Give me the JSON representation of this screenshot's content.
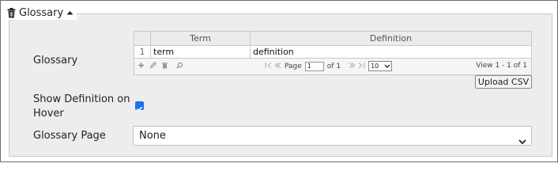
{
  "section": {
    "title": "Glossary"
  },
  "fields": {
    "glossary_label": "Glossary",
    "show_definition_label": "Show Definition on Hover",
    "show_definition_checked": true,
    "glossary_page_label": "Glossary Page",
    "glossary_page_value": "None"
  },
  "grid": {
    "columns": [
      "Term",
      "Definition"
    ],
    "rows": [
      {
        "num": "1",
        "term": "term",
        "definition": "definition"
      }
    ],
    "pager": {
      "page_label": "Page",
      "page_value": "1",
      "of_label": "of 1",
      "page_size": "10",
      "view_text": "View 1 - 1 of 1"
    }
  },
  "buttons": {
    "upload_csv": "Upload CSV"
  },
  "icons": {
    "section": [
      "trash-icon",
      "caret-up-icon"
    ],
    "pager_left": [
      "add-icon",
      "edit-icon",
      "delete-icon",
      "search-icon"
    ],
    "pager_nav": [
      "first-page-icon",
      "prev-page-icon",
      "next-page-icon",
      "last-page-icon"
    ]
  },
  "colors": {
    "accent": "#1a73e8",
    "panel_bg": "#ededed"
  }
}
